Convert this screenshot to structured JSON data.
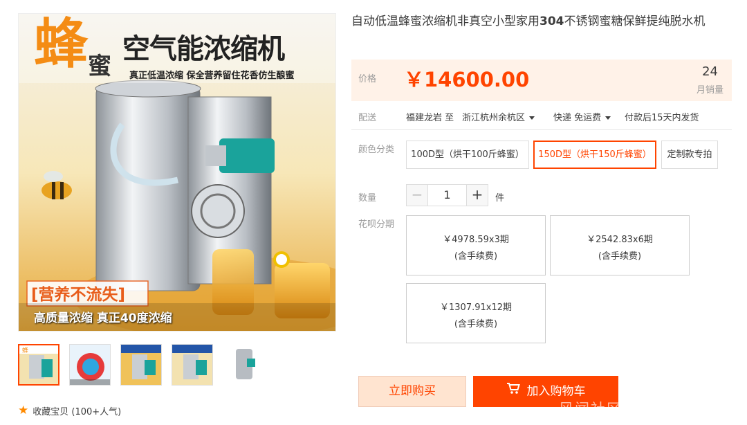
{
  "product": {
    "title_part1": "自动低温蜂蜜浓缩机非真空小型家用",
    "title_bold": "304",
    "title_part2": "不锈钢蜜糖保鲜提纯脱水机"
  },
  "image_overlay": {
    "big_char_1": "蜂",
    "big_char_2": "蜜",
    "headline": "空气能浓缩机",
    "subline": "真正低温浓缩  保全营养留住花香仿生酿蜜",
    "badge": "[营养不流失]",
    "footer": "高质量浓缩 真正40度浓缩"
  },
  "price": {
    "label": "价格",
    "value": "￥14600.00",
    "sales_count": "24",
    "sales_label": "月销量"
  },
  "shipping": {
    "label": "配送",
    "from": "福建龙岩 至",
    "to": "浙江杭州余杭区",
    "method": "快递 免运费",
    "note": "付款后15天内发货"
  },
  "options": {
    "label": "颜色分类",
    "items": [
      {
        "label": "100D型（烘干100斤蜂蜜）"
      },
      {
        "label": "150D型（烘干150斤蜂蜜）"
      },
      {
        "label": "定制款专拍"
      }
    ]
  },
  "quantity": {
    "label": "数量",
    "minus": "−",
    "value": "1",
    "plus": "+",
    "unit": "件"
  },
  "installments": {
    "label": "花呗分期",
    "plans": [
      {
        "amount": "￥4978.59x3期",
        "fee": "(含手续费)"
      },
      {
        "amount": "￥2542.83x6期",
        "fee": "(含手续费)"
      },
      {
        "amount": "￥1307.91x12期",
        "fee": "(含手续费)"
      }
    ]
  },
  "actions": {
    "buy_now": "立即购买",
    "add_to_cart": "加入购物车"
  },
  "favorite": {
    "text": "收藏宝贝 (100+人气)"
  },
  "watermark": "风闻社区",
  "colors": {
    "accent": "#ff4400",
    "price_bg": "#fff2e8",
    "buy_bg": "#ffe4d0"
  }
}
